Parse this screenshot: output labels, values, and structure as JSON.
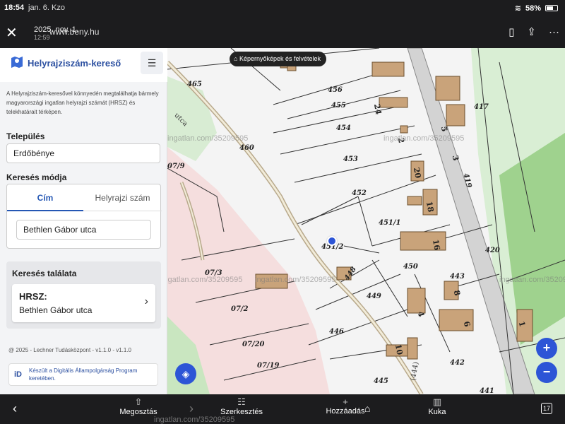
{
  "status": {
    "time": "18:54",
    "date": "jan. 6. Kzo",
    "battery": "58%"
  },
  "browser": {
    "url_date": "2025. nov. 1.",
    "url": "www.beny.hu",
    "url_time": "12:59"
  },
  "chip": {
    "label": "Képernyőképek és felvételek"
  },
  "app": {
    "title": "Helyrajziszám-kereső",
    "intro": "A Helyrajziszám-keresővel könnyedén megtalálhatja bármely magyarországi ingatlan helyrajzi számát (HRSZ) és telekhatárait térképen.",
    "settlement_label": "Település",
    "settlement_value": "Erdőbénye",
    "search_mode_label": "Keresés módja",
    "tabs": {
      "address": "Cím",
      "parcel": "Helyrajzi szám"
    },
    "street_value": "Bethlen Gábor utca",
    "result_title": "Keresés találata",
    "result_hrsz": "HRSZ:",
    "result_street": "Bethlen Gábor utca",
    "version": "@ 2025 - Lechner Tudásközpont - v1.1.0 - v1.1.0",
    "program_logo": "iD",
    "program_text": "Készült a Digitális Állampolgárság Program keretében."
  },
  "map": {
    "watermark": "ingatlan.com/35209595",
    "zoom_in": "+",
    "zoom_out": "−",
    "parcels": [
      "465",
      "456",
      "455",
      "417",
      "454",
      "460",
      "453",
      "419",
      "07/9",
      "452",
      "451/1",
      "420",
      "451/2",
      "448",
      "450",
      "443",
      "07/3",
      "449",
      "07/2",
      "446",
      "07/20",
      "442",
      "07/19",
      "445",
      "441"
    ],
    "buildings": [
      "24",
      "2",
      "5",
      "3",
      "20",
      "18",
      "16",
      "8",
      "6",
      "1",
      "10",
      "4"
    ],
    "streets": [
      "utca",
      "(444)"
    ]
  },
  "toolbar": {
    "share": "Megosztás",
    "edit": "Szerkesztés",
    "add": "Hozzáadás",
    "trash": "Kuka",
    "pages": "17",
    "watermark": "ingatlan.com/35209595"
  }
}
